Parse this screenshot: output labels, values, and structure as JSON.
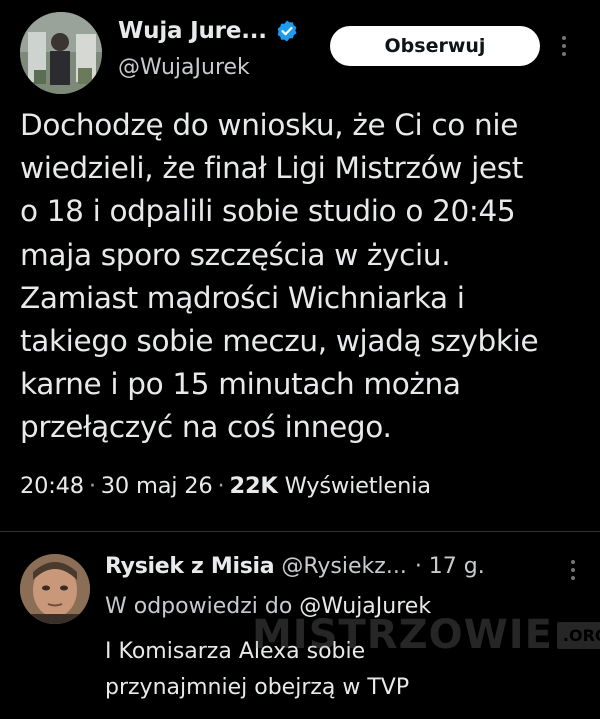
{
  "tweet": {
    "author_name": "Wuja Jure...",
    "author_handle": "@WujaJurek",
    "follow_label": "Obserwuj",
    "text": "Dochodzę do wniosku, że Ci co nie\nwiedzieli, że finał Ligi Mistrzów jest\no 18 i odpalili sobie studio o 20:45\nmaja sporo szczęścia w życiu.\nZamiast mądrości Wichniarka i\ntakiego sobie meczu, wjadą szybkie\nkarne i po 15 minutach można\nprzełączyć na coś innego.",
    "time": "20:48",
    "date": "30 maj 26",
    "views_count": "22K",
    "views_label": "Wyświetlenia",
    "sep": "·"
  },
  "reply": {
    "author_name": "Rysiek z Misia",
    "author_handle": "@Rysiekz...",
    "time": "· 17 g.",
    "reply_to_prefix": "W odpowiedzi do",
    "reply_to_handle": "@WujaJurek",
    "text": "I Komisarza Alexa sobie\nprzynajmniej obejrzą w TVP"
  },
  "watermark": {
    "main": "MISTRZOWIE",
    "tld": ".ORG"
  },
  "colors": {
    "background": "#000000",
    "text_primary": "#e7e9ea",
    "text_secondary": "#c8cbcd",
    "verified_blue": "#1d9bf0",
    "follow_bg": "#ffffff",
    "divider": "#2f3336"
  },
  "icons": {
    "verified": "verified-badge-icon",
    "more": "more-options-icon"
  }
}
